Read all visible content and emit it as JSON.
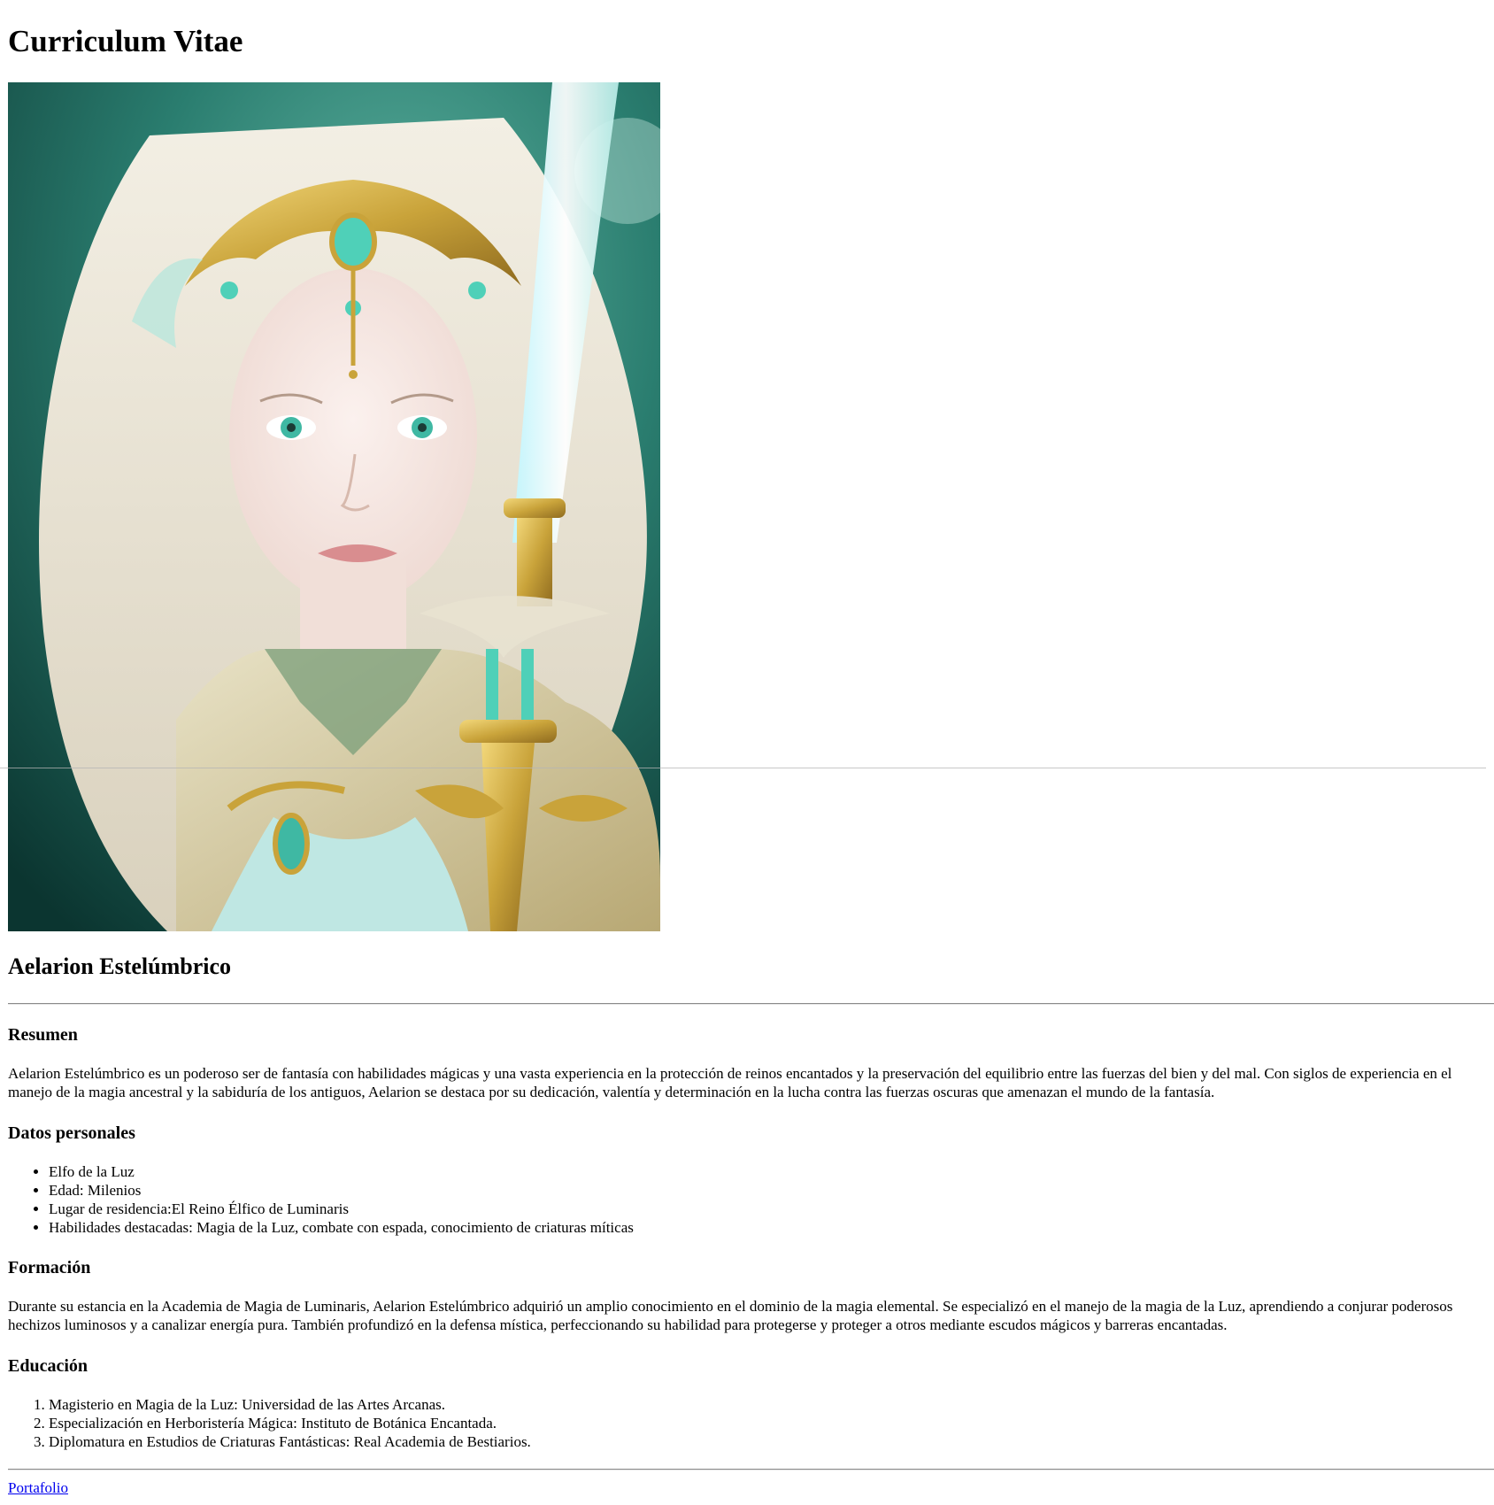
{
  "page_title": "Curriculum Vitae",
  "name": "Aelarion Estelúmbrico",
  "sections": {
    "resumen": {
      "heading": "Resumen",
      "text": "Aelarion Estelúmbrico es un poderoso ser de fantasía con habilidades mágicas y una vasta experiencia en la protección de reinos encantados y la preservación del equilibrio entre las fuerzas del bien y del mal. Con siglos de experiencia en el manejo de la magia ancestral y la sabiduría de los antiguos, Aelarion se destaca por su dedicación, valentía y determinación en la lucha contra las fuerzas oscuras que amenazan el mundo de la fantasía."
    },
    "datos": {
      "heading": "Datos personales",
      "items": [
        "Elfo de la Luz",
        "Edad: Milenios",
        "Lugar de residencia:El Reino Élfico de Luminaris",
        "Habilidades destacadas: Magia de la Luz, combate con espada, conocimiento de criaturas míticas"
      ]
    },
    "formacion": {
      "heading": "Formación",
      "text": "Durante su estancia en la Academia de Magia de Luminaris, Aelarion Estelúmbrico adquirió un amplio conocimiento en el dominio de la magia elemental. Se especializó en el manejo de la magia de la Luz, aprendiendo a conjurar poderosos hechizos luminosos y a canalizar energía pura. También profundizó en la defensa mística, perfeccionando su habilidad para protegerse y proteger a otros mediante escudos mágicos y barreras encantadas."
    },
    "educacion": {
      "heading": "Educación",
      "items": [
        "Magisterio en Magia de la Luz: Universidad de las Artes Arcanas.",
        "Especialización en Herboristería Mágica: Instituto de Botánica Encantada.",
        "Diplomatura en Estudios de Criaturas Fantásticas: Real Academia de Bestiarios."
      ]
    }
  },
  "footer_link": "Portafolio",
  "colors": {
    "link": "#0000ee",
    "forest_dark": "#0d3b35",
    "forest_teal": "#2f8f7f",
    "hair": "#e9e3d4",
    "gold": "#c9a33a",
    "gem": "#4fd0b8",
    "skin": "#f4e6e0"
  }
}
